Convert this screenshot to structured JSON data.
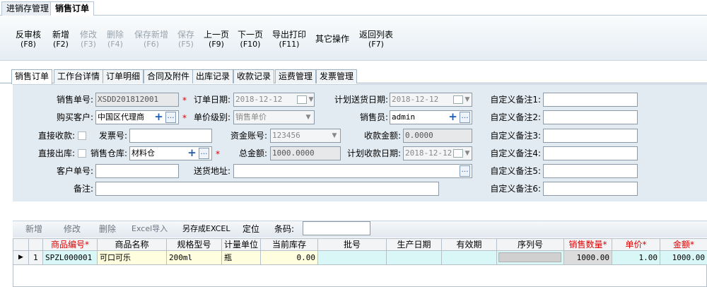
{
  "app_tabs": [
    {
      "label": "进销存管理"
    },
    {
      "label": "销售订单"
    }
  ],
  "toolbar": [
    {
      "label": "反审核",
      "key": "(F8)",
      "enabled": true
    },
    {
      "label": "新增",
      "key": "(F2)",
      "enabled": true
    },
    {
      "label": "修改",
      "key": "(F3)",
      "enabled": false
    },
    {
      "label": "删除",
      "key": "(F4)",
      "enabled": false
    },
    {
      "label": "保存新增",
      "key": "(F6)",
      "enabled": false
    },
    {
      "label": "保存",
      "key": "(F5)",
      "enabled": false
    },
    {
      "label": "上一页",
      "key": "(F9)",
      "enabled": true
    },
    {
      "label": "下一页",
      "key": "(F10)",
      "enabled": true
    },
    {
      "label": "导出打印",
      "key": "(F11)",
      "enabled": true
    },
    {
      "label": "其它操作",
      "key": "",
      "enabled": true
    },
    {
      "label": "返回列表",
      "key": "(F7)",
      "enabled": true
    }
  ],
  "form_tabs": [
    "销售订单",
    "工作台详情",
    "订单明细",
    "合同及附件",
    "出库记录",
    "收款记录",
    "运费管理",
    "发票管理"
  ],
  "form": {
    "order_no_label": "销售单号:",
    "order_no": "XSDD201812001",
    "order_date_label": "订单日期:",
    "order_date": "2018-12-12",
    "plan_ship_label": "计划送货日期:",
    "plan_ship": "2018-12-12",
    "customer_label": "购买客户:",
    "customer": "中国区代理商",
    "price_level_label": "单价级别:",
    "price_level": "销售单价",
    "salesman_label": "销售员:",
    "salesman": "admin",
    "direct_collect_label": "直接收款:",
    "invoice_label": "发票号:",
    "invoice": "",
    "fund_account_label": "资金账号:",
    "fund_account": "123456",
    "collected_label": "收款金额:",
    "collected": "0.0000",
    "direct_out_label": "直接出库:",
    "warehouse_label": "销售仓库:",
    "warehouse": "材料仓",
    "total_label": "总金额:",
    "total": "1000.0000",
    "plan_collect_label": "计划收款日期:",
    "plan_collect": "2018-12-12",
    "cust_order_label": "客户单号:",
    "cust_order": "",
    "address_label": "送货地址:",
    "address": "",
    "remark_label": "备注:",
    "remark": "",
    "custom_labels": [
      "自定义备注1:",
      "自定义备注2:",
      "自定义备注3:",
      "自定义备注4:",
      "自定义备注5:",
      "自定义备注6:"
    ],
    "required_mark": "*"
  },
  "grid_toolbar": {
    "add": "新增",
    "edit": "修改",
    "delete": "删除",
    "excel_import": "Excel导入",
    "save_excel": "另存成EXCEL",
    "locate": "定位",
    "barcode_label": "条码:",
    "barcode": ""
  },
  "grid": {
    "columns": [
      "商品编号*",
      "商品名称",
      "规格型号",
      "计量单位",
      "当前库存",
      "批号",
      "生产日期",
      "有效期",
      "序列号",
      "销售数量*",
      "单价*",
      "金额*"
    ],
    "rows": [
      {
        "indicator": "▶",
        "row_no": "1",
        "code": "SPZL000001",
        "name": "可口可乐",
        "spec": "200ml",
        "unit": "瓶",
        "stock": "0.00",
        "batch": "",
        "prod_date": "",
        "expiry": "",
        "serial": "",
        "qty": "1000.00",
        "price": "1.00",
        "amount": "1000.00"
      }
    ]
  }
}
